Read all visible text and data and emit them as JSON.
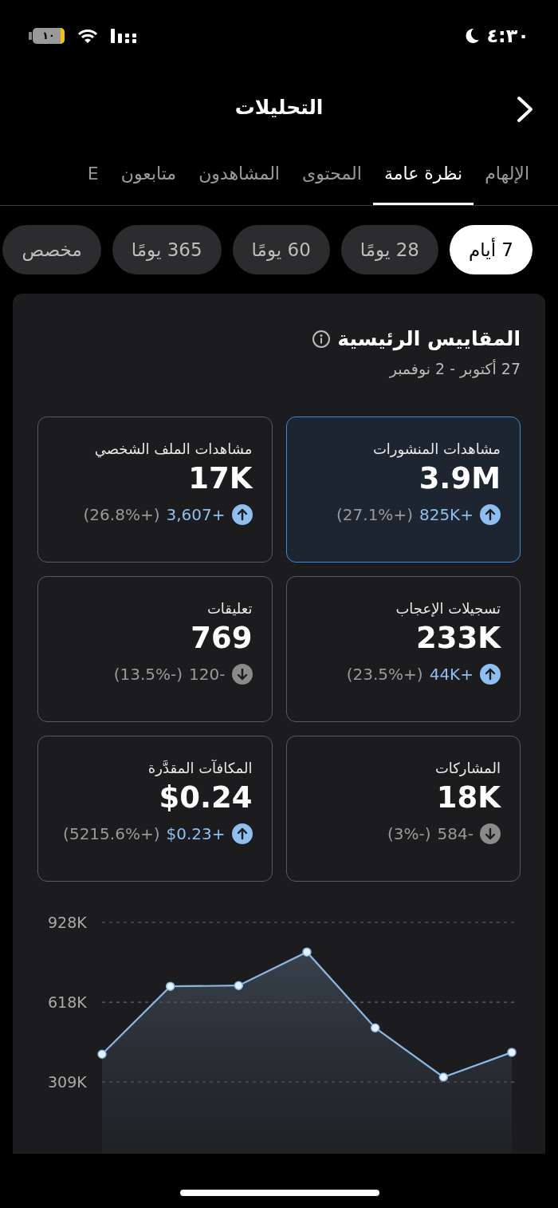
{
  "status_bar": {
    "time": "٤:٣٠",
    "battery": "١٠"
  },
  "header": {
    "title": "التحليلات"
  },
  "tabs": [
    {
      "label": "الإلهام",
      "selected": false
    },
    {
      "label": "نظرة عامة",
      "selected": true
    },
    {
      "label": "المحتوى",
      "selected": false
    },
    {
      "label": "المشاهدون",
      "selected": false
    },
    {
      "label": "متابعون",
      "selected": false
    },
    {
      "label": "E",
      "selected": false
    }
  ],
  "ranges": [
    {
      "label": "7 أيام",
      "selected": true
    },
    {
      "label": "28 يومًا",
      "selected": false
    },
    {
      "label": "60 يومًا",
      "selected": false
    },
    {
      "label": "365 يومًا",
      "selected": false
    },
    {
      "label": "مخصص",
      "selected": false
    }
  ],
  "metrics_panel": {
    "title": "المقاييس الرئيسية",
    "date_range": "27 أكتوبر - 2 نوفمبر",
    "metrics": [
      {
        "label": "مشاهدات المنشورات",
        "value": "3.9M",
        "change": "+825K",
        "percent": "(+27.1%)",
        "trend_up": true,
        "selected": true
      },
      {
        "label": "مشاهدات الملف الشخصي",
        "value": "17K",
        "change": "+3,607",
        "percent": "(+26.8%)",
        "trend_up": true,
        "selected": false
      },
      {
        "label": "تسجيلات الإعجاب",
        "value": "233K",
        "change": "+44K",
        "percent": "(+23.5%)",
        "trend_up": true,
        "selected": false
      },
      {
        "label": "تعليقات",
        "value": "769",
        "change": "-120",
        "percent": "(-13.5%)",
        "trend_up": false,
        "selected": false
      },
      {
        "label": "المشاركات",
        "value": "18K",
        "change": "-584",
        "percent": "(-3%)",
        "trend_up": false,
        "selected": false
      },
      {
        "label": "المكافآت المقدَّرة",
        "value": "$0.24",
        "change": "+$0.23",
        "percent": "(+5215.6%)",
        "trend_up": true,
        "selected": false
      }
    ],
    "chart_data": {
      "type": "area",
      "series": [
        {
          "color": "#8ab8e6",
          "values": [
            417000,
            680000,
            683000,
            813000,
            519000,
            328000,
            424000
          ]
        }
      ],
      "ylim": [
        0,
        928000
      ],
      "yticks": [
        {
          "value": 309000,
          "label": "309K"
        },
        {
          "value": 618000,
          "label": "618K"
        },
        {
          "value": 928000,
          "label": "928K"
        }
      ]
    }
  }
}
